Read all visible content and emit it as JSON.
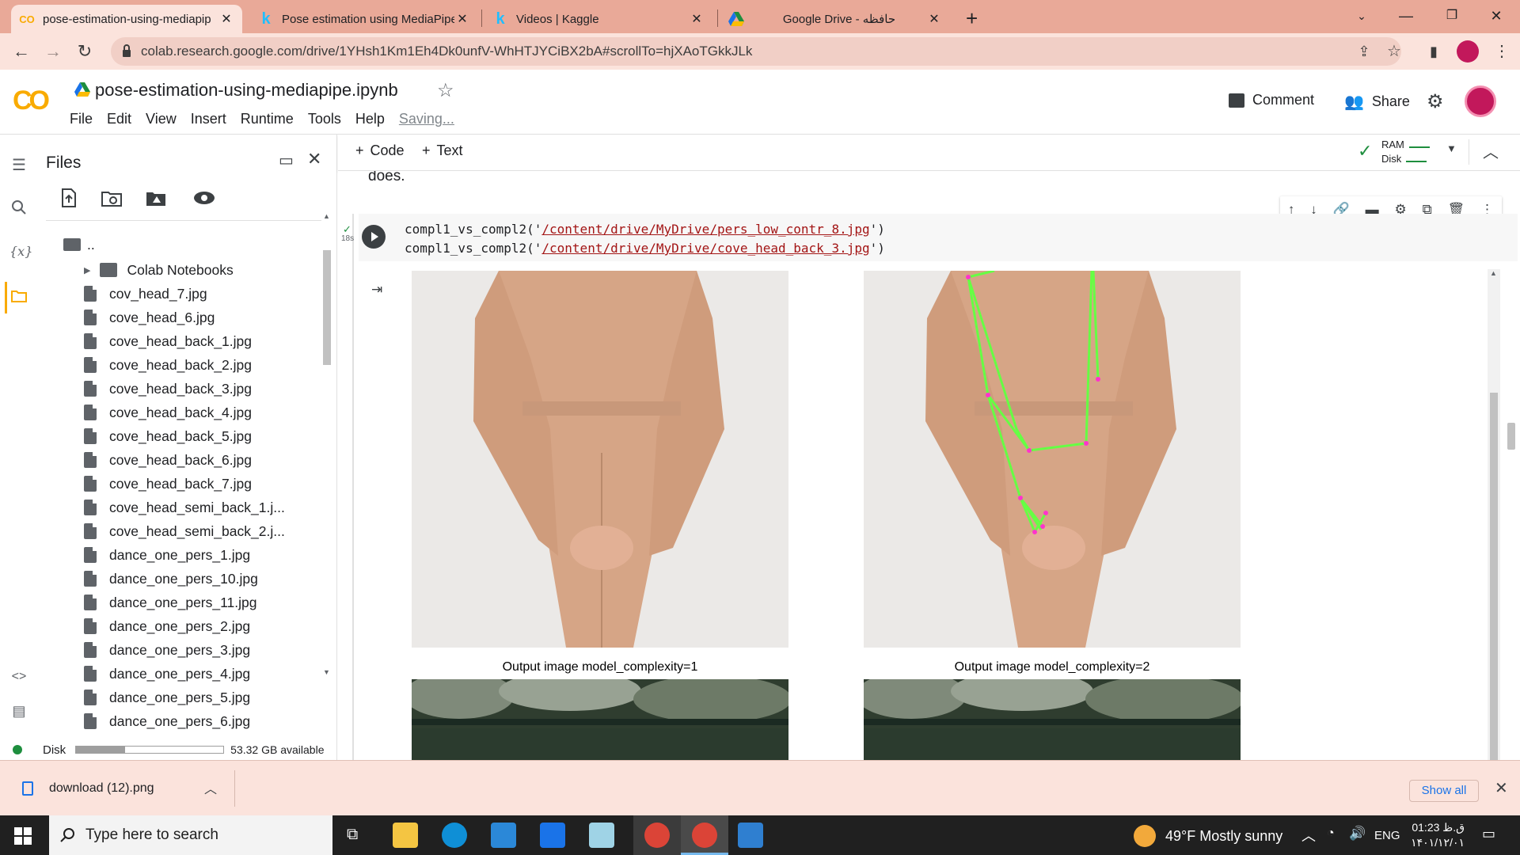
{
  "browser": {
    "tabs": [
      {
        "title": "pose-estimation-using-mediapip",
        "icon": "colab-icon",
        "active": true
      },
      {
        "title": "Pose estimation using MediaPipe",
        "icon": "kaggle-icon",
        "active": false
      },
      {
        "title": "Videos | Kaggle",
        "icon": "kaggle-icon",
        "active": false
      },
      {
        "title": "Google Drive - حافظه",
        "icon": "google-drive-icon",
        "active": false
      }
    ],
    "url": "colab.research.google.com/drive/1YHsh1Km1Eh4Dk0unfV-WhHTJYCiBX2bA#scrollTo=hjXAoTGkkJLk"
  },
  "colab": {
    "logo": "CO",
    "notebook_title": "pose-estimation-using-mediapipe.ipynb",
    "menu": [
      "File",
      "Edit",
      "View",
      "Insert",
      "Runtime",
      "Tools",
      "Help"
    ],
    "saving_status": "Saving...",
    "comment_label": "Comment",
    "share_label": "Share",
    "add_code_label": "Code",
    "add_text_label": "Text",
    "ram_label": "RAM",
    "disk_label": "Disk"
  },
  "files_panel": {
    "title": "Files",
    "parent_label": "..",
    "folder": "Colab Notebooks",
    "items": [
      "cov_head_7.jpg",
      "cove_head_6.jpg",
      "cove_head_back_1.jpg",
      "cove_head_back_2.jpg",
      "cove_head_back_3.jpg",
      "cove_head_back_4.jpg",
      "cove_head_back_5.jpg",
      "cove_head_back_6.jpg",
      "cove_head_back_7.jpg",
      "cove_head_semi_back_1.j...",
      "cove_head_semi_back_2.j...",
      "dance_one_pers_1.jpg",
      "dance_one_pers_10.jpg",
      "dance_one_pers_11.jpg",
      "dance_one_pers_2.jpg",
      "dance_one_pers_3.jpg",
      "dance_one_pers_4.jpg",
      "dance_one_pers_5.jpg",
      "dance_one_pers_6.jpg"
    ],
    "disk_label": "Disk",
    "disk_available": "53.32 GB available",
    "disk_used_fraction": 0.33
  },
  "notebook": {
    "text_tail": "does.",
    "exec_time": "18s",
    "code_lines": [
      {
        "pre": "compl1_vs_compl2('",
        "path": "/content/drive/MyDrive/pers_low_contr_8.jpg",
        "post": "')"
      },
      {
        "pre": "compl1_vs_compl2('",
        "path": "/content/drive/MyDrive/cove_head_back_3.jpg",
        "post": "')"
      }
    ],
    "captions": [
      "Output image model_complexity=1",
      "Output image model_complexity=2"
    ]
  },
  "download_bar": {
    "filename": "download (12).png",
    "show_all": "Show all"
  },
  "taskbar": {
    "search_placeholder": "Type here to search",
    "weather": "49°F  Mostly sunny",
    "language": "ENG",
    "time": "01:23 ق.ظ",
    "date": "۱۴۰۱/۱۲/۰۱"
  },
  "colors": {
    "tabstrip": "#e9a998",
    "toolbar": "#fbe3dc",
    "skin": "#d9a98a",
    "pose_line": "#66ff44",
    "pose_point": "#ff33cc",
    "colab_orange": "#f9ab00"
  }
}
